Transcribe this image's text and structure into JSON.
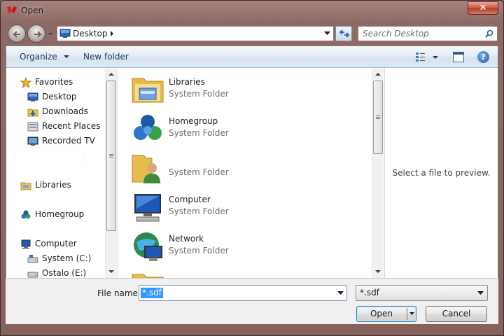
{
  "window": {
    "title": "Open"
  },
  "titlebar": {
    "close_label": "✕"
  },
  "address": {
    "location": "Desktop"
  },
  "search": {
    "placeholder": "Search Desktop"
  },
  "toolbar": {
    "organize_label": "Organize",
    "new_folder_label": "New folder"
  },
  "nav_pane": {
    "favorites": [
      "Favorites",
      "Desktop",
      "Downloads",
      "Recent Places",
      "Recorded TV"
    ],
    "libraries": "Libraries",
    "homegroup": "Homegroup",
    "computer": [
      "Computer",
      "System (C:)",
      "Ostalo (E:)"
    ]
  },
  "files": [
    {
      "name": "Libraries",
      "type": "System Folder",
      "icon": "libraries-icon"
    },
    {
      "name": "Homegroup",
      "type": "System Folder",
      "icon": "homegroup-icon"
    },
    {
      "name": "",
      "type": "System Folder",
      "icon": "user-folder-icon"
    },
    {
      "name": "Computer",
      "type": "System Folder",
      "icon": "computer-icon"
    },
    {
      "name": "Network",
      "type": "System Folder",
      "icon": "network-icon"
    }
  ],
  "preview": {
    "message": "Select a file to preview."
  },
  "bottom": {
    "file_name_label": "File name:",
    "file_name_value": "*.sdf",
    "file_type_value": "*.sdf",
    "open_label": "Open",
    "cancel_label": "Cancel"
  },
  "colors": {
    "frame": "#8e6a66",
    "selection": "#3399ff",
    "toolbar_text": "#1e395b"
  }
}
